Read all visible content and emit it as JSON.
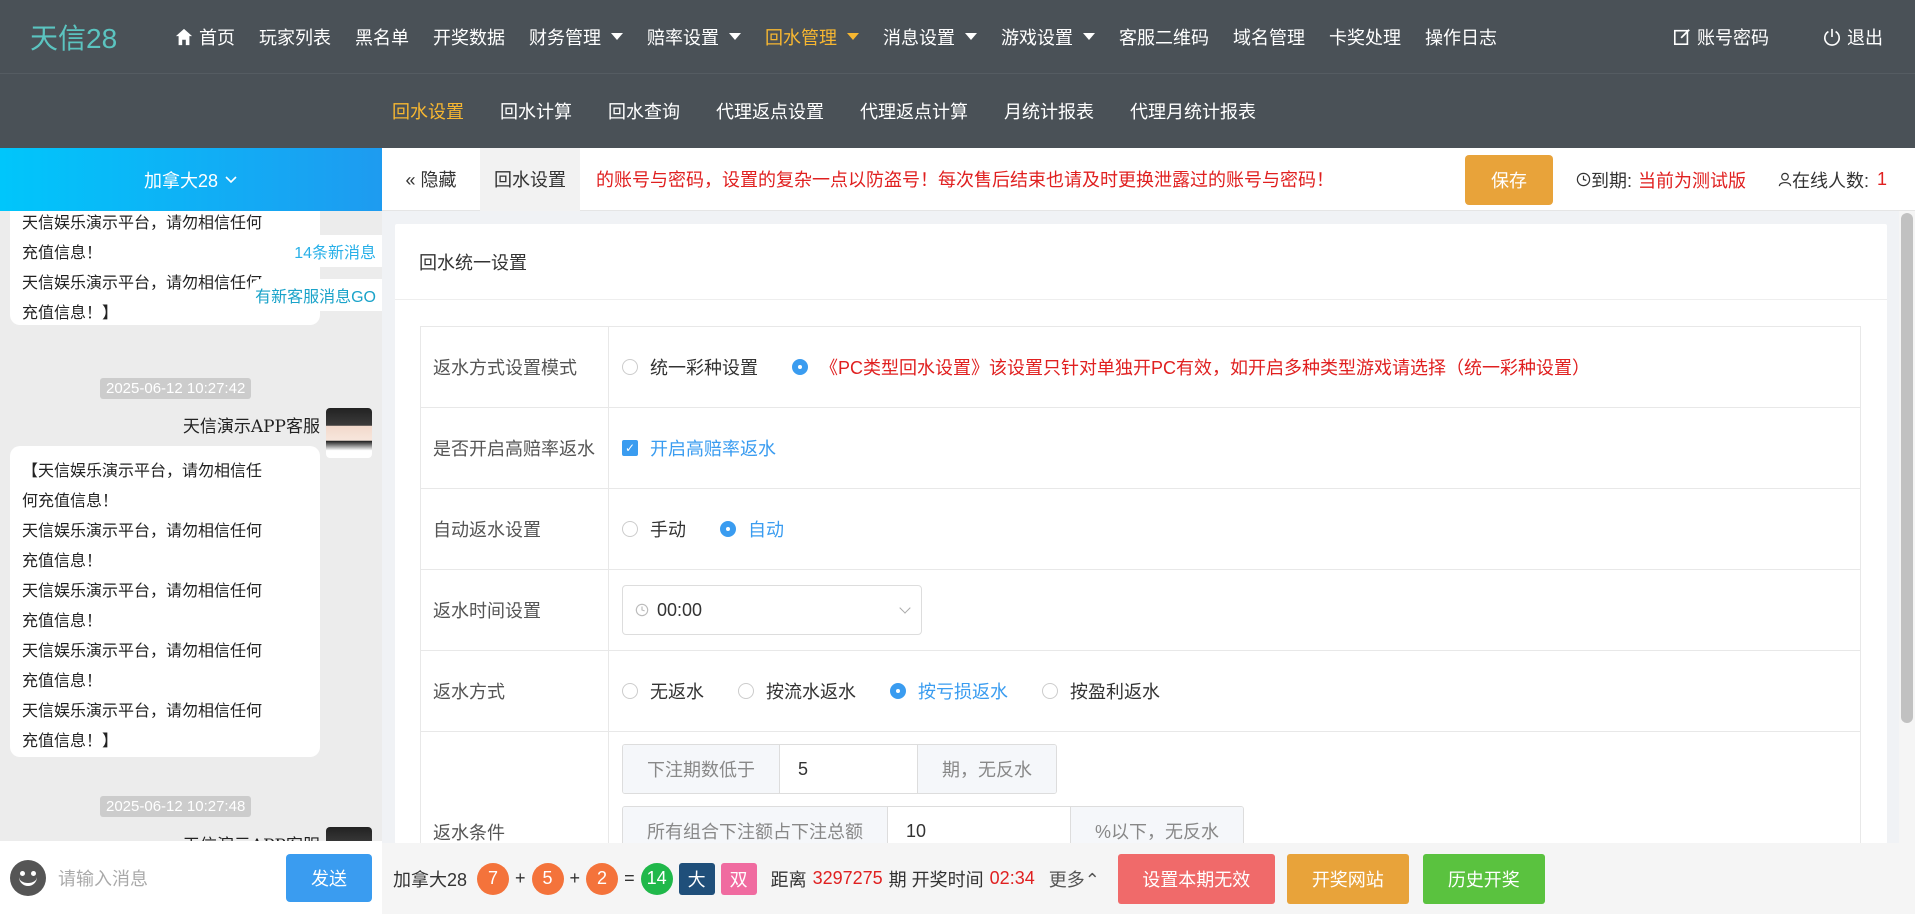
{
  "app": {
    "logo": "天信28"
  },
  "topnav": {
    "items": [
      {
        "label": "首页",
        "icon": "home-icon"
      },
      {
        "label": "玩家列表"
      },
      {
        "label": "黑名单"
      },
      {
        "label": "开奖数据"
      },
      {
        "label": "财务管理",
        "dropdown": true
      },
      {
        "label": "赔率设置",
        "dropdown": true
      },
      {
        "label": "回水管理",
        "dropdown": true,
        "active": true
      },
      {
        "label": "消息设置",
        "dropdown": true
      },
      {
        "label": "游戏设置",
        "dropdown": true
      },
      {
        "label": "客服二维码"
      },
      {
        "label": "域名管理"
      },
      {
        "label": "卡奖处理"
      },
      {
        "label": "操作日志"
      }
    ],
    "account_label": "账号密码",
    "logout_label": "退出"
  },
  "subnav": {
    "items": [
      "回水设置",
      "回水计算",
      "回水查询",
      "代理返点设置",
      "代理返点计算",
      "月统计报表",
      "代理月统计报表"
    ],
    "active_index": 0
  },
  "chat": {
    "room": "加拿大28",
    "new_msg_notice": "14条新消息",
    "cs_notice": "有新客服消息GO",
    "messages": [
      {
        "lines": [
          "天信娱乐演示平台，请勿相信任何",
          "充值信息！",
          "天信娱乐演示平台，请勿相信任何",
          "充值信息！】"
        ]
      },
      {
        "time": "2025-06-12 10:27:42",
        "sender": "天信演示APP客服",
        "lines": [
          "【天信娱乐演示平台，请勿相信任",
          "何充值信息！",
          "天信娱乐演示平台，请勿相信任何",
          "充值信息！",
          "天信娱乐演示平台，请勿相信任何",
          "充值信息！",
          "天信娱乐演示平台，请勿相信任何",
          "充值信息！",
          "天信娱乐演示平台，请勿相信任何",
          "充值信息！】"
        ]
      },
      {
        "time": "2025-06-12 10:27:48",
        "sender": "天信演示APP客服"
      }
    ],
    "input_placeholder": "请输入消息",
    "send_label": "发送"
  },
  "tabbar": {
    "hide_label": "隐藏",
    "tab_label": "回水设置",
    "marquee": "的账号与密码，设置的复杂一点以防盗号！每次售后结束也请及时更换泄露过的账号与密码！",
    "save_label": "保存",
    "expire_label": "到期:",
    "expire_value": "当前为测试版",
    "online_label": "在线人数:",
    "online_value": "1"
  },
  "form": {
    "card_title": "回水统一设置",
    "rows": {
      "mode": {
        "label": "返水方式设置模式",
        "opt1": "统一彩种设置",
        "opt2": "《PC类型回水设置》该设置只针对单独开PC有效，如开启多种类型游戏请选择（统一彩种设置）",
        "selected": 2
      },
      "high": {
        "label": "是否开启高赔率返水",
        "check_label": "开启高赔率返水",
        "checked": true
      },
      "auto": {
        "label": "自动返水设置",
        "opt1": "手动",
        "opt2": "自动",
        "selected": 2
      },
      "time": {
        "label": "返水时间设置",
        "value": "00:00"
      },
      "method": {
        "label": "返水方式",
        "options": [
          "无返水",
          "按流水返水",
          "按亏损返水",
          "按盈利返水"
        ],
        "selected": 2
      },
      "cond": {
        "label": "返水条件",
        "c1_pre": "下注期数低于",
        "c1_val": "5",
        "c1_post": "期，无反水",
        "c2_pre": "所有组合下注额占下注总额",
        "c2_val": "10",
        "c2_post": "%以下，无反水"
      }
    }
  },
  "bottom": {
    "game": "加拿大28",
    "n1": "7",
    "n2": "5",
    "n3": "2",
    "sum": "14",
    "plus": "+",
    "eq": "=",
    "big": "大",
    "even": "双",
    "dist_label": "距离",
    "period": "3297275",
    "period_label": "期 开奖时间",
    "countdown": "02:34",
    "more_label": "更多",
    "btn_invalid": "设置本期无效",
    "btn_site": "开奖网站",
    "btn_history": "历史开奖"
  },
  "colors": {
    "accent": "#3a9cf0",
    "active_nav": "#f7b731",
    "danger": "#e02020",
    "save": "#e8a33a"
  }
}
